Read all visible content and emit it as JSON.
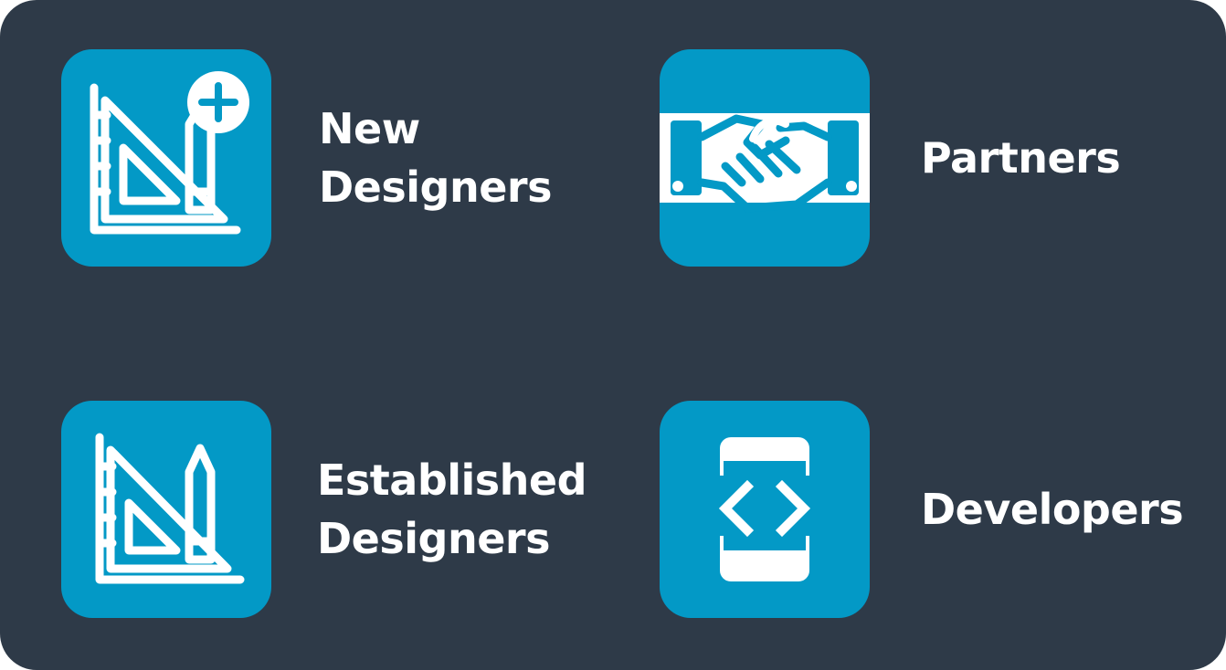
{
  "colors": {
    "panel_background": "#2e3a48",
    "tile_background": "#0399c6",
    "text": "#ffffff"
  },
  "cards": [
    {
      "id": "new-designers",
      "icon": "triangle-ruler-pencil-plus-icon",
      "label_lines": [
        "New",
        "Designers"
      ]
    },
    {
      "id": "partners",
      "icon": "handshake-icon",
      "label_lines": [
        "Partners"
      ]
    },
    {
      "id": "established-designers",
      "icon": "triangle-ruler-pencil-icon",
      "label_lines": [
        "Established",
        "Designers"
      ]
    },
    {
      "id": "developers",
      "icon": "mobile-code-icon",
      "label_lines": [
        "Developers"
      ]
    }
  ]
}
